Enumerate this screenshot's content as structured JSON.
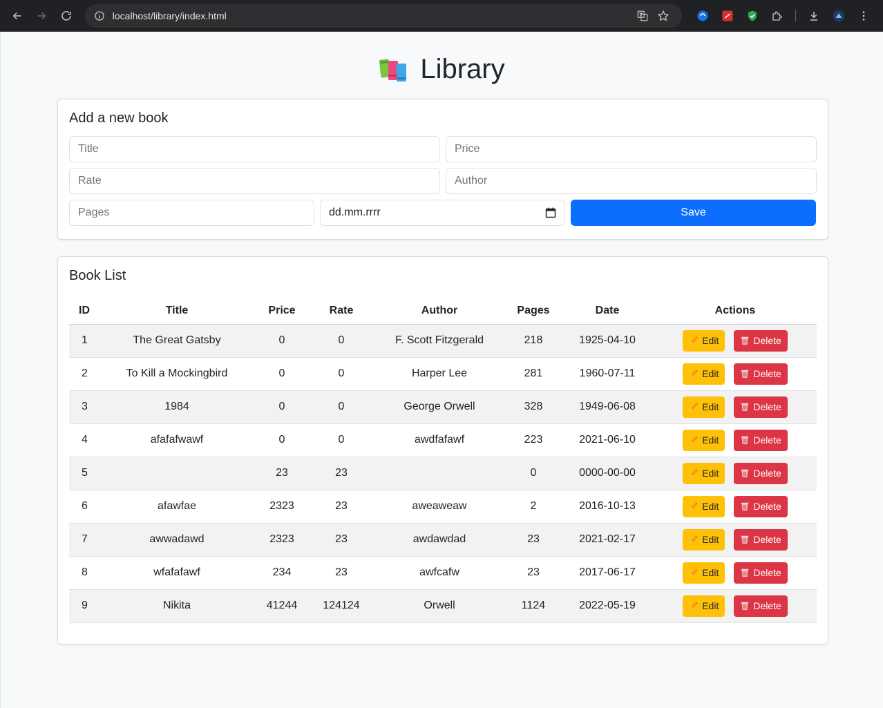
{
  "browser": {
    "url": "localhost/library/index.html"
  },
  "page": {
    "title": "Library"
  },
  "form": {
    "heading": "Add a new book",
    "title_placeholder": "Title",
    "price_placeholder": "Price",
    "rate_placeholder": "Rate",
    "author_placeholder": "Author",
    "pages_placeholder": "Pages",
    "date_value": "dd.mm.rrrr",
    "save_label": "Save"
  },
  "list": {
    "heading": "Book List",
    "columns": {
      "id": "ID",
      "title": "Title",
      "price": "Price",
      "rate": "Rate",
      "author": "Author",
      "pages": "Pages",
      "date": "Date",
      "actions": "Actions"
    },
    "edit_label": "Edit",
    "delete_label": "Delete",
    "rows": [
      {
        "id": "1",
        "title": "The Great Gatsby",
        "price": "0",
        "rate": "0",
        "author": "F. Scott Fitzgerald",
        "pages": "218",
        "date": "1925-04-10"
      },
      {
        "id": "2",
        "title": "To Kill a Mockingbird",
        "price": "0",
        "rate": "0",
        "author": "Harper Lee",
        "pages": "281",
        "date": "1960-07-11"
      },
      {
        "id": "3",
        "title": "1984",
        "price": "0",
        "rate": "0",
        "author": "George Orwell",
        "pages": "328",
        "date": "1949-06-08"
      },
      {
        "id": "4",
        "title": "afafafwawf",
        "price": "0",
        "rate": "0",
        "author": "awdfafawf",
        "pages": "223",
        "date": "2021-06-10"
      },
      {
        "id": "5",
        "title": "",
        "price": "23",
        "rate": "23",
        "author": "",
        "pages": "0",
        "date": "0000-00-00"
      },
      {
        "id": "6",
        "title": "afawfae",
        "price": "2323",
        "rate": "23",
        "author": "aweaweaw",
        "pages": "2",
        "date": "2016-10-13"
      },
      {
        "id": "7",
        "title": "awwadawd",
        "price": "2323",
        "rate": "23",
        "author": "awdawdad",
        "pages": "23",
        "date": "2021-02-17"
      },
      {
        "id": "8",
        "title": "wfafafawf",
        "price": "234",
        "rate": "23",
        "author": "awfcafw",
        "pages": "23",
        "date": "2017-06-17"
      },
      {
        "id": "9",
        "title": "Nikita",
        "price": "41244",
        "rate": "124124",
        "author": "Orwell",
        "pages": "1124",
        "date": "2022-05-19"
      }
    ]
  },
  "icons": {
    "edit": "pencil-icon",
    "delete": "wastebasket-icon",
    "title": "books-icon"
  },
  "colors": {
    "primary": "#0d6efd",
    "warning": "#ffc107",
    "danger": "#dc3545"
  }
}
